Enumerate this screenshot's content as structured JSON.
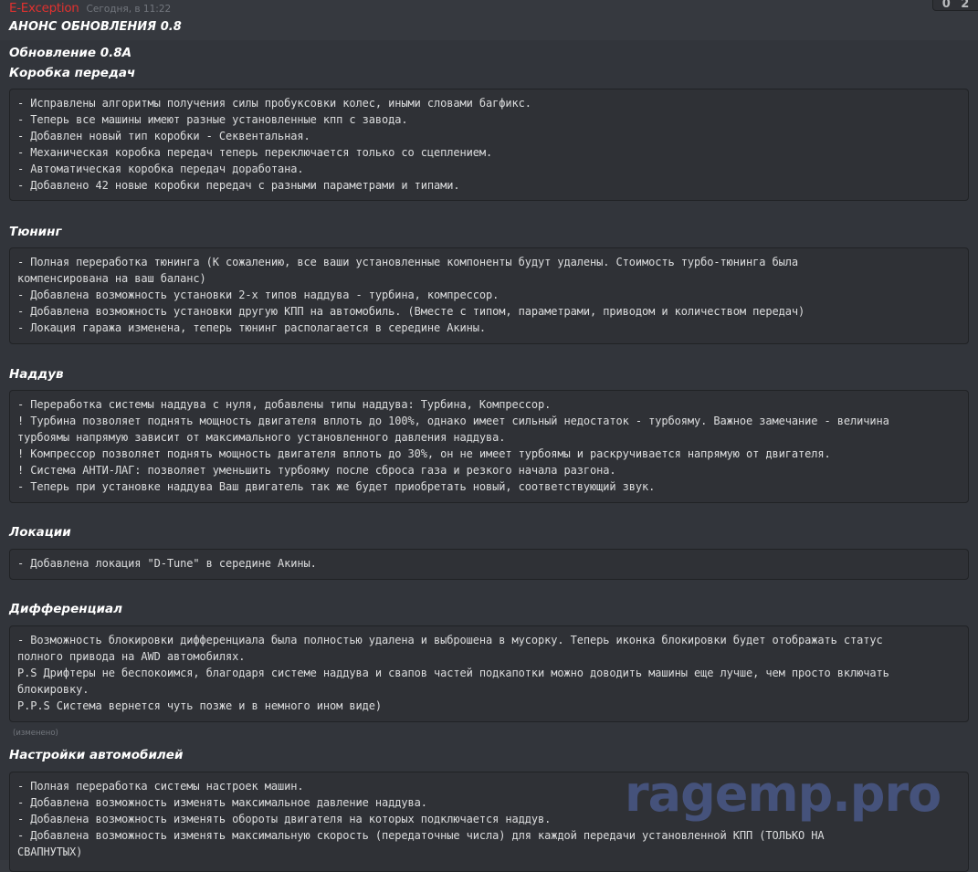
{
  "message": {
    "author": "E-Exception",
    "timestamp": "Сегодня, в 11:22",
    "title": "АНОНС ОБНОВЛЕНИЯ 0.8",
    "edited_label": "(изменено)"
  },
  "corner": {
    "glyph_1": "0",
    "glyph_2": "2"
  },
  "version_heading": "Обновление 0.8A",
  "sections": [
    {
      "heading": "Коробка передач",
      "lines": [
        "- Исправлены алгоритмы получения силы пробуксовки колес, иными словами багфикс.",
        "- Теперь все машины имеют разные установленные кпп с завода.",
        "- Добавлен новый тип коробки - Секвентальная.",
        "- Механическая коробка передач теперь переключается только со сцеплением.",
        "- Автоматическая коробка передач доработана.",
        "- Добавлено 42 новые коробки передач с разными параметрами и типами."
      ]
    },
    {
      "heading": "Тюнинг",
      "lines": [
        "- Полная переработка тюнинга (К сожалению, все ваши установленные компоненты будут удалены. Стоимость турбо-тюнинга была",
        "компенсирована на ваш баланс)",
        "- Добавлена возможность установки 2-х типов наддува - турбина, компрессор.",
        "- Добавлена возможность установки другую КПП на автомобиль. (Вместе с типом, параметрами, приводом и количеством передач)",
        "- Локация гаража изменена, теперь тюнинг располагается в середине Акины."
      ]
    },
    {
      "heading": "Наддув",
      "lines": [
        "- Переработка системы наддува с нуля, добавлены типы наддува: Турбина, Компрессор.",
        "! Турбина позволяет поднять мощность двигателя вплоть до 100%, однако имеет сильный недостаток - турбояму. Важное замечание - величина",
        "турбоямы напрямую зависит от максимального установленного давления наддува.",
        "! Компрессор позволяет поднять мощность двигателя вплоть до 30%, он не имеет турбоямы и раскручивается напрямую от двигателя.",
        "! Система АНТИ-ЛАГ: позволяет уменьшить турбояму после сброса газа и резкого начала разгона.",
        "- Теперь при установке наддува Ваш двигатель так же будет приобретать новый, соответствующий звук."
      ]
    },
    {
      "heading": "Локации",
      "lines": [
        "- Добавлена локация \"D-Tune\" в середине Акины."
      ]
    },
    {
      "heading": "Дифференциал",
      "lines": [
        "- Возможность блокировки дифференциала была полностью удалена и выброшена в мусорку. Теперь иконка блокировки будет отображать статус",
        "полного привода на AWD автомобилях.",
        "P.S Дрифтеры не беспокоимся, благодаря системе наддува и свапов частей подкапотки можно доводить машины еще лучше, чем просто включать",
        "блокировку.",
        "P.P.S Система вернется чуть позже и в немного ином виде)"
      ]
    },
    {
      "heading": "Настройки автомобилей",
      "lines": [
        "- Полная переработка системы настроек машин.",
        "- Добавлена возможность изменять максимальное давление наддува.",
        "- Добавлена возможность изменять обороты двигателя на которых подключается наддув.",
        "- Добавлена возможность изменять максимальную скорость (передаточные числа) для каждой передачи установленной КПП (ТОЛЬКО НА",
        "СВАПНУТЫХ)"
      ]
    }
  ],
  "watermark": "ragemp.pro"
}
